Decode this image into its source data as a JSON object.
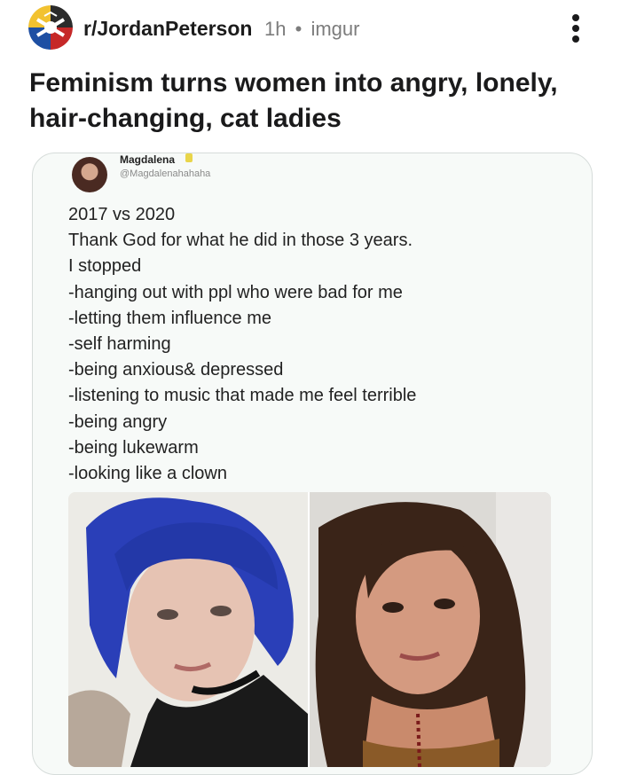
{
  "post": {
    "subreddit": "r/JordanPeterson",
    "age": "1h",
    "separator": "•",
    "source": "imgur",
    "title": "Feminism turns women into angry, lonely, hair-changing, cat ladies"
  },
  "tweet": {
    "name": "Magdalena",
    "handle": "@Magdalenahahaha",
    "lines": [
      "2017 vs 2020",
      "Thank God for what he did in those 3 years.",
      "I stopped",
      "-hanging out with ppl who were bad for me",
      "-letting them influence me",
      "-self harming",
      "-being anxious& depressed",
      "-listening to music that made me feel terrible",
      "-being angry",
      "-being lukewarm",
      "-looking like a clown"
    ]
  },
  "icons": {
    "subreddit_avatar": "subreddit-avatar-icon",
    "overflow": "more-vertical-icon"
  },
  "colors": {
    "text": "#1a1a1b",
    "meta": "#7c7c7c",
    "hair_blue": "#2a3fb8"
  }
}
